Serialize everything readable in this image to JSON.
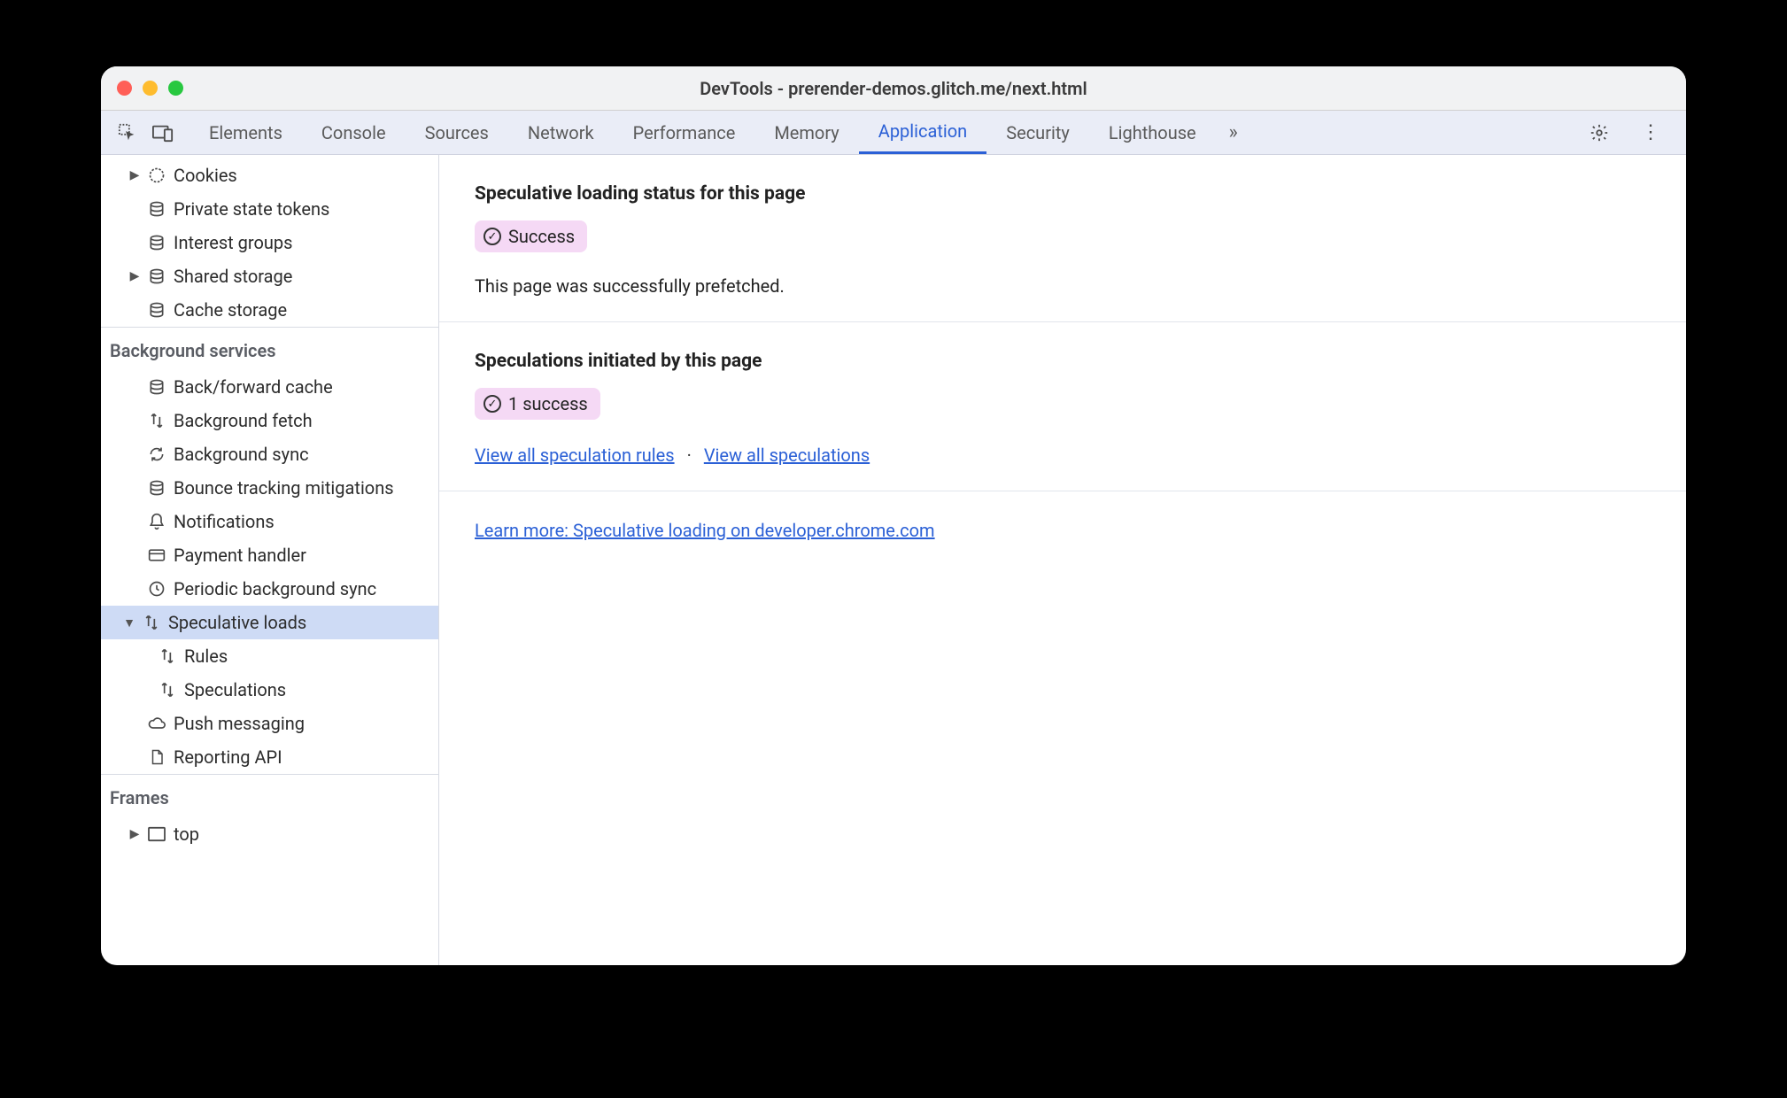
{
  "window": {
    "title": "DevTools - prerender-demos.glitch.me/next.html"
  },
  "tabs": {
    "items": [
      "Elements",
      "Console",
      "Sources",
      "Network",
      "Performance",
      "Memory",
      "Application",
      "Security",
      "Lighthouse"
    ],
    "active": "Application"
  },
  "sidebar": {
    "storage": {
      "items": [
        {
          "label": "Cookies",
          "icon": "cookie",
          "caret": "right"
        },
        {
          "label": "Private state tokens",
          "icon": "db"
        },
        {
          "label": "Interest groups",
          "icon": "db"
        },
        {
          "label": "Shared storage",
          "icon": "db",
          "caret": "right"
        },
        {
          "label": "Cache storage",
          "icon": "db"
        }
      ]
    },
    "background": {
      "header": "Background services",
      "items": [
        {
          "label": "Back/forward cache",
          "icon": "db"
        },
        {
          "label": "Background fetch",
          "icon": "arrows"
        },
        {
          "label": "Background sync",
          "icon": "sync"
        },
        {
          "label": "Bounce tracking mitigations",
          "icon": "db"
        },
        {
          "label": "Notifications",
          "icon": "bell"
        },
        {
          "label": "Payment handler",
          "icon": "card"
        },
        {
          "label": "Periodic background sync",
          "icon": "clock"
        },
        {
          "label": "Speculative loads",
          "icon": "arrows",
          "caret": "down",
          "selected": true,
          "children": [
            {
              "label": "Rules",
              "icon": "arrows"
            },
            {
              "label": "Speculations",
              "icon": "arrows"
            }
          ]
        },
        {
          "label": "Push messaging",
          "icon": "cloud"
        },
        {
          "label": "Reporting API",
          "icon": "doc"
        }
      ]
    },
    "frames": {
      "header": "Frames",
      "items": [
        {
          "label": "top",
          "icon": "frame",
          "caret": "right"
        }
      ]
    }
  },
  "panel": {
    "section1": {
      "heading": "Speculative loading status for this page",
      "badge": "Success",
      "text": "This page was successfully prefetched."
    },
    "section2": {
      "heading": "Speculations initiated by this page",
      "badge": "1 success",
      "link1": "View all speculation rules",
      "link2": "View all speculations"
    },
    "section3": {
      "learn_more": "Learn more: Speculative loading on developer.chrome.com"
    }
  }
}
